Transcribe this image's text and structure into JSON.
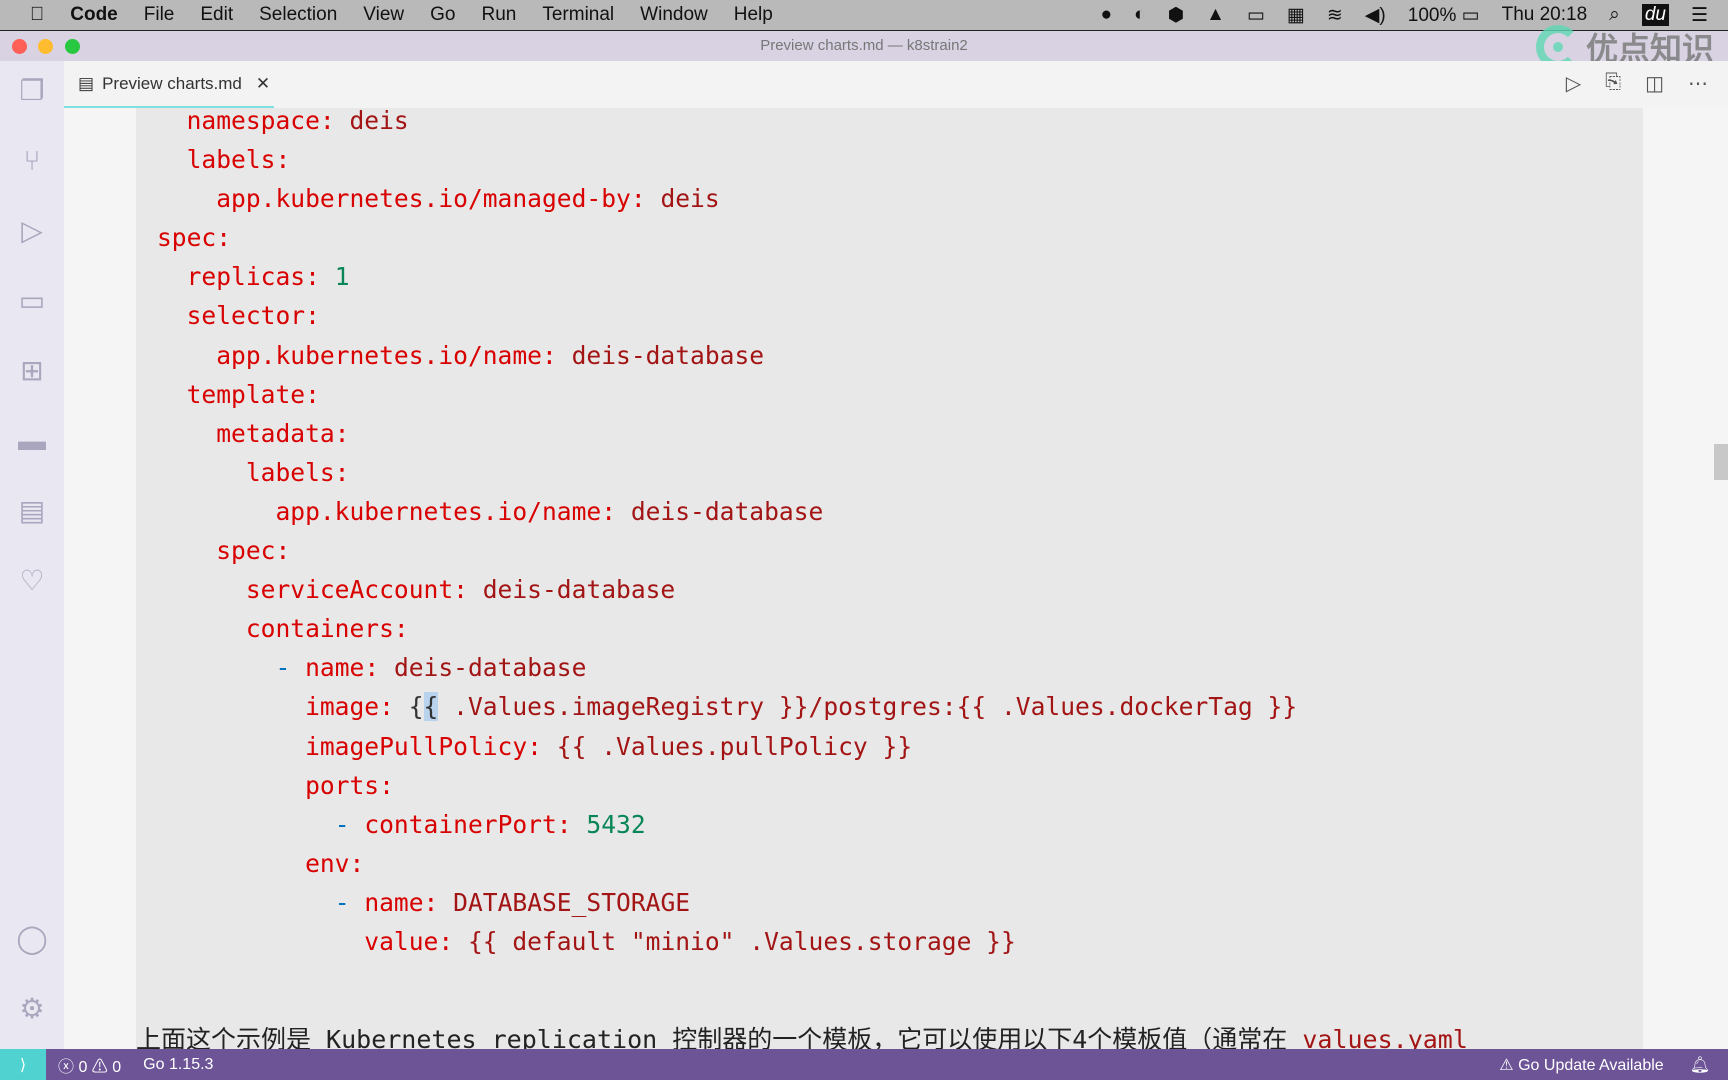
{
  "menubar": {
    "app": "Code",
    "items": [
      "File",
      "Edit",
      "Selection",
      "View",
      "Go",
      "Run",
      "Terminal",
      "Window",
      "Help"
    ],
    "battery": "100%",
    "clock": "Thu 20:18"
  },
  "window": {
    "title": "Preview charts.md — k8strain2",
    "watermark": "优点知识"
  },
  "tab": {
    "label": "Preview charts.md"
  },
  "code": [
    [
      [
        "  namespace: ",
        "k"
      ],
      [
        "deis",
        "v"
      ]
    ],
    [
      [
        "  labels:",
        "k"
      ]
    ],
    [
      [
        "    app.kubernetes.io/managed-by: ",
        "k"
      ],
      [
        "deis",
        "v"
      ]
    ],
    [
      [
        "spec:",
        "k"
      ]
    ],
    [
      [
        "  replicas: ",
        "k"
      ],
      [
        "1",
        "n"
      ]
    ],
    [
      [
        "  selector:",
        "k"
      ]
    ],
    [
      [
        "    app.kubernetes.io/name: ",
        "k"
      ],
      [
        "deis-database",
        "v"
      ]
    ],
    [
      [
        "  template:",
        "k"
      ]
    ],
    [
      [
        "    metadata:",
        "k"
      ]
    ],
    [
      [
        "      labels:",
        "k"
      ]
    ],
    [
      [
        "        app.kubernetes.io/name: ",
        "k"
      ],
      [
        "deis-database",
        "v"
      ]
    ],
    [
      [
        "    spec:",
        "k"
      ]
    ],
    [
      [
        "      serviceAccount: ",
        "k"
      ],
      [
        "deis-database",
        "v"
      ]
    ],
    [
      [
        "      containers:",
        "k"
      ]
    ],
    [
      [
        "        ",
        "p"
      ],
      [
        "- ",
        "d"
      ],
      [
        "name: ",
        "k"
      ],
      [
        "deis-database",
        "v"
      ]
    ],
    [
      [
        "          image: ",
        "k"
      ],
      [
        "{",
        "p"
      ],
      [
        "{",
        "hl"
      ],
      [
        " .Values.imageRegistry }}/postgres:{{ .Values.dockerTag }}",
        "v"
      ]
    ],
    [
      [
        "          imagePullPolicy: ",
        "k"
      ],
      [
        "{{ .Values.pullPolicy }}",
        "v"
      ]
    ],
    [
      [
        "          ports:",
        "k"
      ]
    ],
    [
      [
        "            ",
        "p"
      ],
      [
        "- ",
        "d"
      ],
      [
        "containerPort: ",
        "k"
      ],
      [
        "5432",
        "n"
      ]
    ],
    [
      [
        "          env:",
        "k"
      ]
    ],
    [
      [
        "            ",
        "p"
      ],
      [
        "- ",
        "d"
      ],
      [
        "name: ",
        "k"
      ],
      [
        "DATABASE_STORAGE",
        "v"
      ]
    ],
    [
      [
        "              value: ",
        "k"
      ],
      [
        "{{ default \"minio\" .Values.storage }}",
        "v"
      ]
    ]
  ],
  "paragraph": {
    "text": "上面这个示例是 Kubernetes replication 控制器的一个模板，它可以使用以下4个模板值（通常在 ",
    "code": "values.yaml"
  },
  "status": {
    "errors": "0",
    "warnings": "0",
    "go_version": "Go 1.15.3",
    "update": "Go Update Available"
  }
}
